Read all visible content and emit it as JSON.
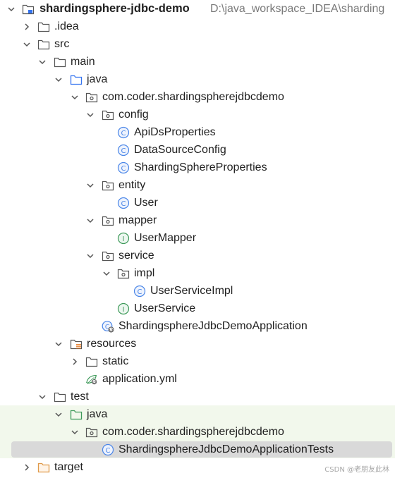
{
  "tree": {
    "root": {
      "label": "shardingsphere-jdbc-demo",
      "path": "D:\\java_workspace_IDEA\\sharding"
    },
    "idea": {
      "label": ".idea"
    },
    "src": {
      "label": "src"
    },
    "main": {
      "label": "main"
    },
    "main_java": {
      "label": "java"
    },
    "main_pkg": {
      "label": "com.coder.shardingspherejdbcdemo"
    },
    "config": {
      "label": "config"
    },
    "api_ds_properties": {
      "label": "ApiDsProperties"
    },
    "datasource_config": {
      "label": "DataSourceConfig"
    },
    "sharding_sphere_properties": {
      "label": "ShardingSphereProperties"
    },
    "entity": {
      "label": "entity"
    },
    "user": {
      "label": "User"
    },
    "mapper": {
      "label": "mapper"
    },
    "user_mapper": {
      "label": "UserMapper"
    },
    "service": {
      "label": "service"
    },
    "impl": {
      "label": "impl"
    },
    "user_service_impl": {
      "label": "UserServiceImpl"
    },
    "user_service": {
      "label": "UserService"
    },
    "app": {
      "label": "ShardingsphereJdbcDemoApplication"
    },
    "resources": {
      "label": "resources"
    },
    "static": {
      "label": "static"
    },
    "application_yml": {
      "label": "application.yml"
    },
    "test": {
      "label": "test"
    },
    "test_java": {
      "label": "java"
    },
    "test_pkg": {
      "label": "com.coder.shardingspherejdbcdemo"
    },
    "app_tests": {
      "label": "ShardingsphereJdbcDemoApplicationTests"
    },
    "target": {
      "label": "target"
    }
  },
  "icons": {
    "chevron": "chevron-icon",
    "folder": "folder-icon",
    "source_folder": "source-folder-icon",
    "test_source_folder": "test-source-folder-icon",
    "resources_folder": "resources-folder-icon",
    "excluded_folder": "excluded-folder-icon",
    "package": "package-icon",
    "class": "class-icon",
    "interface": "interface-icon",
    "spring_boot_class": "spring-boot-class-icon",
    "yaml": "yaml-spring-icon"
  },
  "colors": {
    "class": "#4a86e8",
    "interface": "#3e9a5a",
    "test_folder": "#3e9a5a",
    "source_folder": "#3574f0",
    "target_folder": "#e09a4a",
    "resources_marker": "#e8873a",
    "selection": "#d9d9d9",
    "test_background": "#f2f8ec"
  },
  "watermark": "CSDN @老朋友此林"
}
